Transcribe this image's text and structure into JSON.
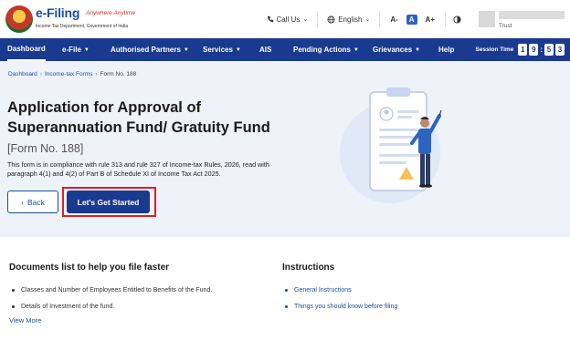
{
  "header": {
    "logo_title": "e-Filing",
    "logo_tagline": "Anywhere Anytime",
    "logo_dept": "Income Tax Department, Government of India",
    "call_us": "Call Us",
    "language": "English",
    "font_decrease": "A-",
    "font_normal": "A",
    "font_increase": "A+",
    "contrast_icon": "contrast-icon",
    "user_role": "Trust"
  },
  "nav": {
    "items": [
      {
        "label": "Dashboard",
        "active": true,
        "has_caret": false
      },
      {
        "label": "e-File",
        "has_caret": true
      },
      {
        "label": "Authorised Partners",
        "has_caret": true
      },
      {
        "label": "Services",
        "has_caret": true
      },
      {
        "label": "AIS",
        "has_caret": false
      },
      {
        "label": "Pending Actions",
        "has_caret": true
      },
      {
        "label": "Grievances",
        "has_caret": true
      },
      {
        "label": "Help",
        "has_caret": false
      }
    ],
    "session_label": "Session Time",
    "session_digits": [
      "1",
      "9",
      "5",
      "3"
    ]
  },
  "breadcrumb": {
    "items": [
      "Dashboard",
      "Income-tax Forms",
      "Form No. 188"
    ]
  },
  "hero": {
    "title": "Application for Approval of Superannuation Fund/ Gratuity Fund",
    "form_tag": "[Form No. 188]",
    "description": "This form is in compliance with rule 313 and rule 327 of Income-tax Rules, 2026, read with paragraph 4(1) and 4(2) of Part B of Schedule XI of Income Tax Act 2025.",
    "back_label": "Back",
    "start_label": "Let's Get Started",
    "colors": {
      "primary": "#1a3a8f",
      "highlight": "#e02020",
      "hero_bg": "#eef2f9"
    }
  },
  "documents": {
    "heading": "Documents list to help you file faster",
    "items": [
      "Classes and Number of Employees Entitled to Benefits of the Fund.",
      "Details of Investment of the fund."
    ],
    "view_more": "View More"
  },
  "instructions": {
    "heading": "Instructions",
    "items": [
      "General Instructions",
      "Things you should know before filing"
    ]
  }
}
